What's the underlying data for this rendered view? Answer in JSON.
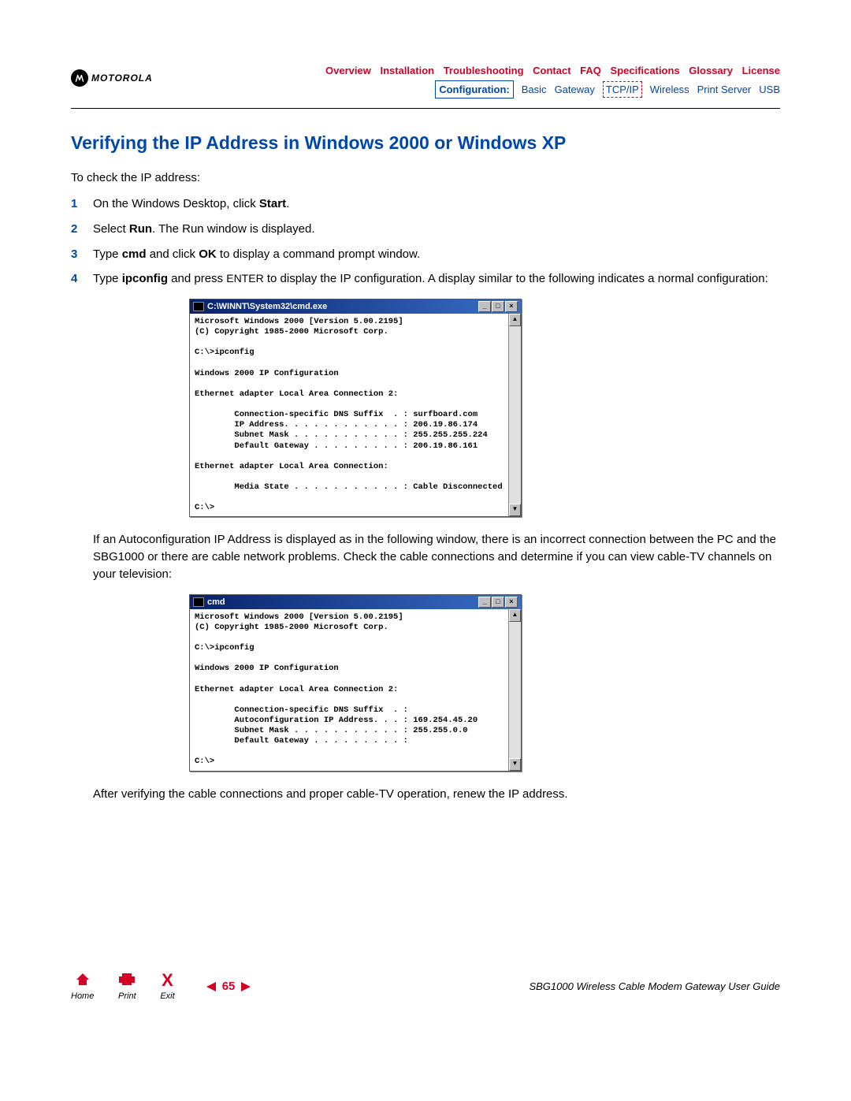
{
  "brand": "MOTOROLA",
  "nav_row1": [
    "Overview",
    "Installation",
    "Troubleshooting",
    "Contact",
    "FAQ",
    "Specifications",
    "Glossary",
    "License"
  ],
  "nav_row2": {
    "boxed": "Configuration:",
    "items": [
      "Basic",
      "Gateway",
      "TCP/IP",
      "Wireless",
      "Print Server",
      "USB"
    ],
    "dashed_index": 2
  },
  "title": "Verifying the IP Address in Windows 2000 or Windows XP",
  "intro": "To check the IP address:",
  "steps": {
    "s1_a": "On the Windows Desktop, click ",
    "s1_b": "Start",
    "s1_c": ".",
    "s2_a": "Select ",
    "s2_b": "Run",
    "s2_c": ". The Run window is displayed.",
    "s3_a": "Type ",
    "s3_b": "cmd",
    "s3_c": " and click ",
    "s3_d": "OK",
    "s3_e": " to display a command prompt window.",
    "s4_a": "Type ",
    "s4_b": "ipconfig",
    "s4_c": " and press ",
    "s4_d": "ENTER",
    "s4_e": " to display the IP configuration. A display similar to the following indicates a normal configuration:"
  },
  "cmd1": {
    "title": "C:\\WINNT\\System32\\cmd.exe",
    "body": "Microsoft Windows 2000 [Version 5.00.2195]\n(C) Copyright 1985-2000 Microsoft Corp.\n\nC:\\>ipconfig\n\nWindows 2000 IP Configuration\n\nEthernet adapter Local Area Connection 2:\n\n        Connection-specific DNS Suffix  . : surfboard.com\n        IP Address. . . . . . . . . . . . : 206.19.86.174\n        Subnet Mask . . . . . . . . . . . : 255.255.255.224\n        Default Gateway . . . . . . . . . : 206.19.86.161\n\nEthernet adapter Local Area Connection:\n\n        Media State . . . . . . . . . . . : Cable Disconnected\n\nC:\\>"
  },
  "para1": "If an Autoconfiguration IP Address is displayed as in the following window, there is an incorrect connection between the PC and the SBG1000 or there are cable network problems. Check the cable connections and determine if you can view cable-TV channels on your television:",
  "cmd2": {
    "title": "cmd",
    "body": "Microsoft Windows 2000 [Version 5.00.2195]\n(C) Copyright 1985-2000 Microsoft Corp.\n\nC:\\>ipconfig\n\nWindows 2000 IP Configuration\n\nEthernet adapter Local Area Connection 2:\n\n        Connection-specific DNS Suffix  . :\n        Autoconfiguration IP Address. . . : 169.254.45.20\n        Subnet Mask . . . . . . . . . . . : 255.255.0.0\n        Default Gateway . . . . . . . . . :\n\nC:\\>"
  },
  "para2": "After verifying the cable connections and proper cable-TV operation, renew the IP address.",
  "footer": {
    "home": "Home",
    "print": "Print",
    "exit": "Exit",
    "page": "65",
    "guide": "SBG1000 Wireless Cable Modem Gateway User Guide"
  }
}
